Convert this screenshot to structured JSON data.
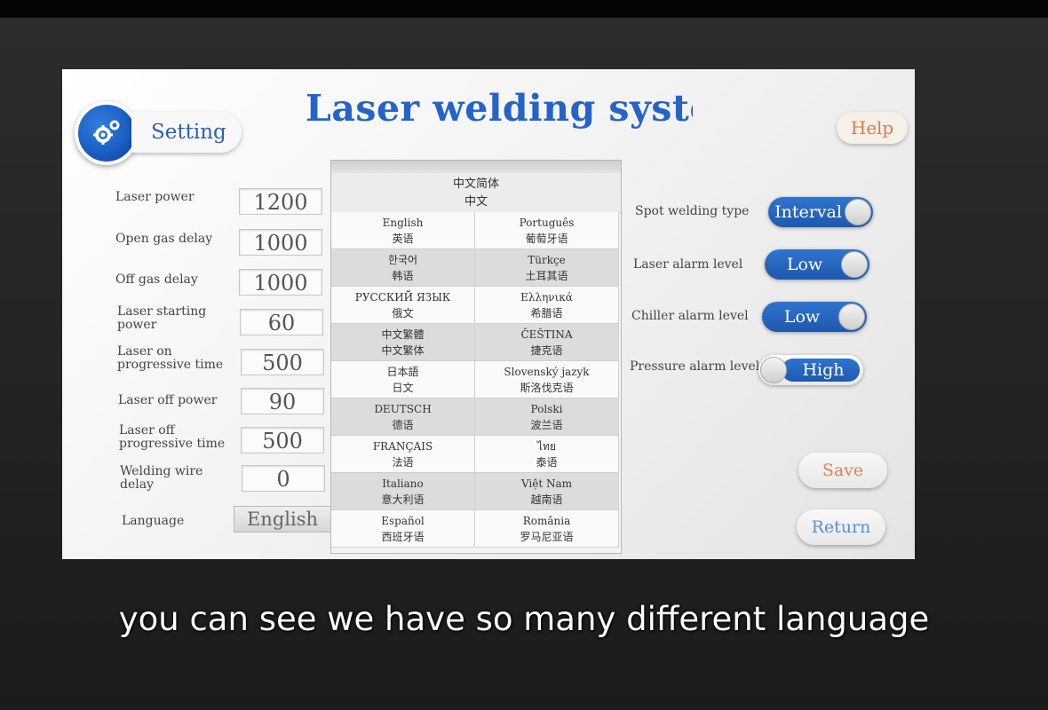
{
  "screen": {
    "title": "Laser welding system",
    "setting_label": "Setting",
    "help_label": "Help"
  },
  "params": [
    {
      "label": "Laser power",
      "value": "1200"
    },
    {
      "label": "Open gas delay",
      "value": "1000"
    },
    {
      "label": "Off gas delay",
      "value": "1000"
    },
    {
      "label": "Laser starting power",
      "value": "60"
    },
    {
      "label": "Laser on progressive time",
      "value": "500"
    },
    {
      "label": "Laser off power",
      "value": "90"
    },
    {
      "label": "Laser off progressive time",
      "value": "500"
    },
    {
      "label": "Welding wire delay",
      "value": "0"
    }
  ],
  "language": {
    "label": "Language",
    "value": "English"
  },
  "language_list": {
    "top": {
      "name": "中文简体",
      "native": "中文"
    },
    "rows": [
      [
        {
          "name": "English",
          "native": "英语"
        },
        {
          "name": "Português",
          "native": "葡萄牙语"
        }
      ],
      [
        {
          "name": "한국어",
          "native": "韩语"
        },
        {
          "name": "Türkçe",
          "native": "土耳其语"
        }
      ],
      [
        {
          "name": "РУССКИЙ ЯЗЫК",
          "native": "俄文"
        },
        {
          "name": "Ελληνικά",
          "native": "希腊语"
        }
      ],
      [
        {
          "name": "中文繁體",
          "native": "中文繁体"
        },
        {
          "name": "ČEŠTINA",
          "native": "捷克语"
        }
      ],
      [
        {
          "name": "日本語",
          "native": "日文"
        },
        {
          "name": "Slovenský jazyk",
          "native": "斯洛伐克语"
        }
      ],
      [
        {
          "name": "DEUTSCH",
          "native": "德语"
        },
        {
          "name": "Polski",
          "native": "波兰语"
        }
      ],
      [
        {
          "name": "FRANÇAIS",
          "native": "法语"
        },
        {
          "name": "ไทย",
          "native": "泰语"
        }
      ],
      [
        {
          "name": "Italiano",
          "native": "意大利语"
        },
        {
          "name": "Việt Nam",
          "native": "越南语"
        }
      ],
      [
        {
          "name": "Español",
          "native": "西班牙语"
        },
        {
          "name": "România",
          "native": "罗马尼亚语"
        }
      ]
    ]
  },
  "settings": [
    {
      "label": "Spot welding type",
      "value": "Interval"
    },
    {
      "label": "Laser alarm level",
      "value": "Low"
    },
    {
      "label": "Chiller alarm level",
      "value": "Low"
    },
    {
      "label": "Pressure alarm level",
      "value": "High"
    }
  ],
  "buttons": {
    "save": "Save",
    "return": "Return"
  },
  "subtitle": "you can see we have so many different language",
  "colors": {
    "accent_blue": "#2563c9",
    "help_orange": "#e07a4a",
    "save_orange": "#e0805a",
    "return_blue": "#5a8fcf"
  }
}
